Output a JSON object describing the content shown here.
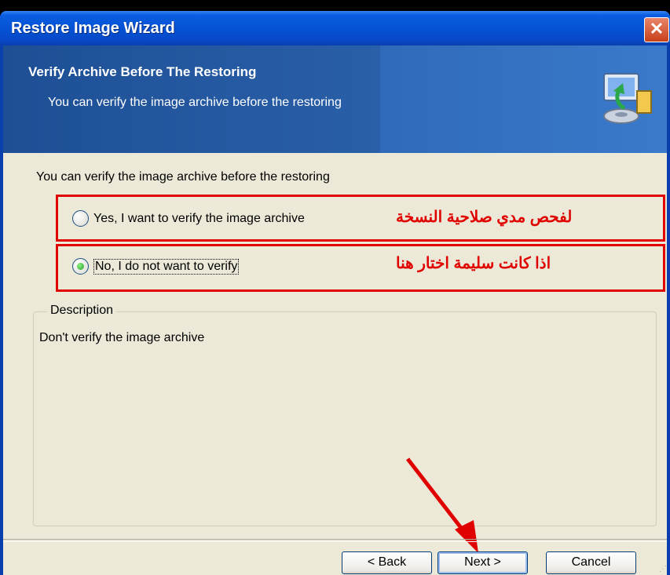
{
  "window": {
    "title": "Restore Image Wizard",
    "close_glyph": "✕"
  },
  "header": {
    "title": "Verify Archive Before The Restoring",
    "subtitle": "You can verify the image archive before the restoring",
    "icon": "restore-computer-icon"
  },
  "content": {
    "intro": "You can verify the image archive before the restoring",
    "options": [
      {
        "label": "Yes, I want to verify the image archive",
        "selected": false,
        "annotation": "لفحص مدي صلاحية النسخة"
      },
      {
        "label": "No, I  do not want to verify",
        "selected": true,
        "annotation": "اذا كانت سليمة اختار هنا"
      }
    ],
    "description": {
      "legend": "Description",
      "text": "Don't verify the image archive"
    }
  },
  "buttons": {
    "back": "< Back",
    "next": "Next >",
    "cancel": "Cancel"
  },
  "colors": {
    "annotation_red": "#e00000",
    "titlebar_blue": "#0553d6",
    "dialog_bg": "#ece9d8"
  }
}
